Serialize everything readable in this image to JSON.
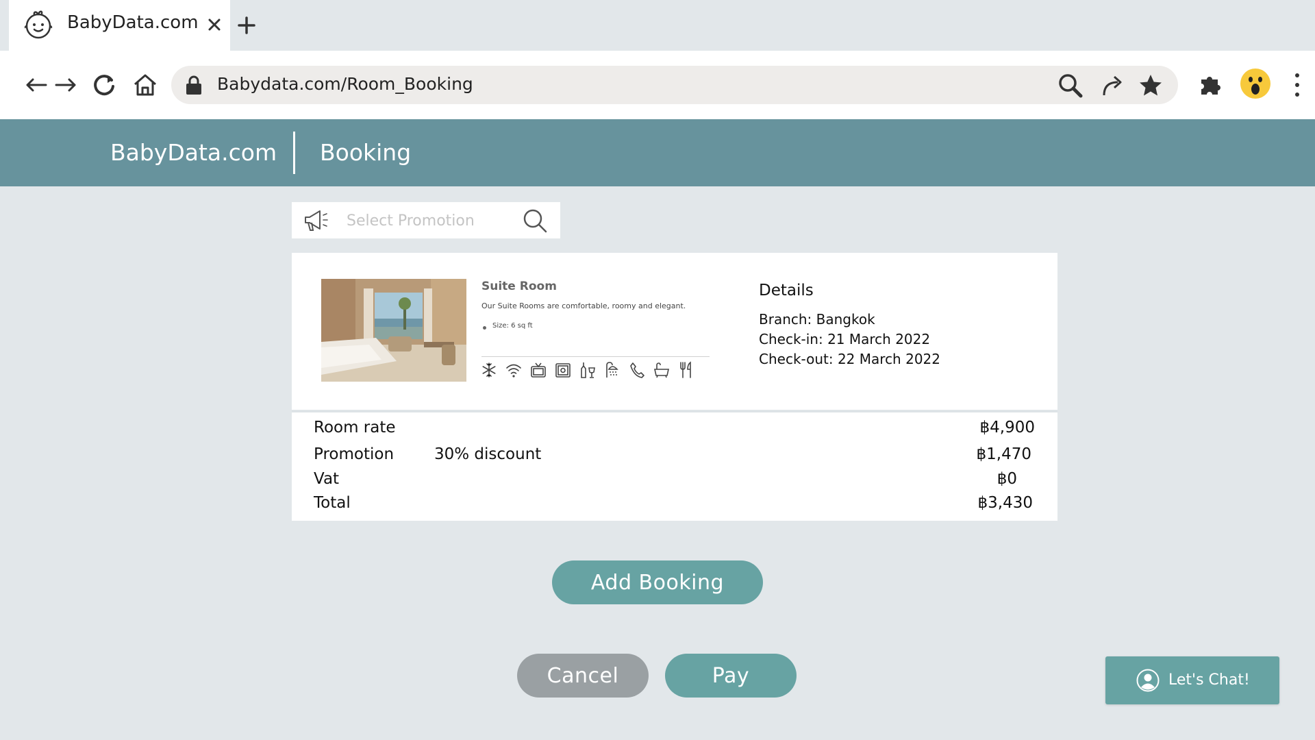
{
  "browser": {
    "tab_title": "BabyData.com",
    "url": "Babydata.com/Room_Booking",
    "icons": [
      "baby-face-icon",
      "close-icon",
      "plus-icon",
      "arrow-left-icon",
      "arrow-right-icon",
      "reload-icon",
      "home-icon",
      "lock-icon",
      "search-icon",
      "share-icon",
      "star-icon",
      "puzzle-icon",
      "surprised-face-icon",
      "kebab-menu-icon"
    ]
  },
  "header": {
    "brand": "BabyData.com",
    "section": "Booking",
    "background": "#67939d"
  },
  "promotion": {
    "placeholder": "Select Promotion"
  },
  "room": {
    "name": "Suite Room",
    "description": "Our Suite Rooms are comfortable, roomy and elegant.",
    "size": "Size: 6 sq ft",
    "amenities": [
      "snowflake-icon",
      "wifi-icon",
      "tv-icon",
      "safe-icon",
      "minibar-icon",
      "shower-icon",
      "phone-icon",
      "bathtub-icon",
      "utensils-icon"
    ]
  },
  "details": {
    "title": "Details",
    "branch": "Branch: Bangkok",
    "checkin": "Check-in: 21 March 2022",
    "checkout": "Check-out: 22 March 2022"
  },
  "prices": {
    "room_rate": {
      "label": "Room rate",
      "value": "฿4,900"
    },
    "promotion": {
      "label": "Promotion",
      "note": "30% discount",
      "value": "฿1,470"
    },
    "vat": {
      "label": "Vat",
      "value": "฿0"
    },
    "total": {
      "label": "Total",
      "value": "฿3,430"
    }
  },
  "actions": {
    "add_booking": "Add Booking",
    "cancel": "Cancel",
    "pay": "Pay"
  },
  "chat": {
    "label": "Let's Chat!"
  },
  "colors": {
    "accent": "#67a3a3",
    "cancel": "#9aa0a3",
    "page_bg": "#e2e7ea"
  }
}
